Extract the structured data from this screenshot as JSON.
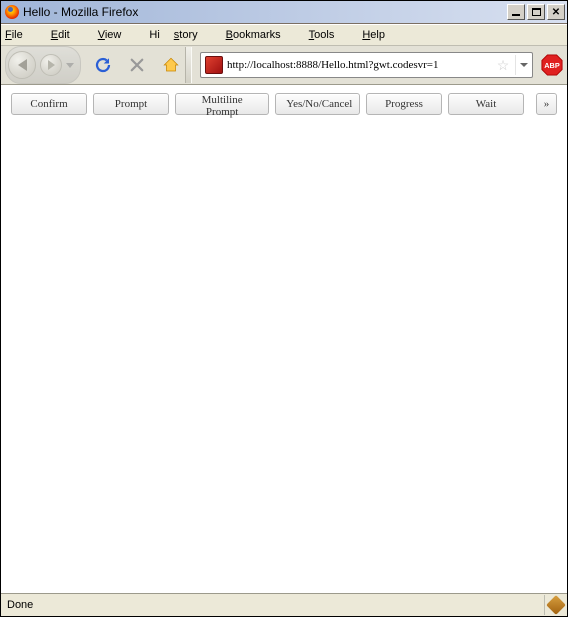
{
  "window": {
    "title": "Hello - Mozilla Firefox"
  },
  "menubar": {
    "file": {
      "letter": "F",
      "rest": "ile"
    },
    "edit": {
      "letter": "E",
      "rest": "dit"
    },
    "view": {
      "letter": "V",
      "rest": "iew"
    },
    "history": {
      "letter": "",
      "rest1": "Hi",
      "letter2": "s",
      "rest2": "tory"
    },
    "bookmarks": {
      "letter": "B",
      "rest": "ookmarks"
    },
    "tools": {
      "letter": "T",
      "rest": "ools"
    },
    "help": {
      "letter": "H",
      "rest": "elp"
    }
  },
  "address": {
    "url": "http://localhost:8888/Hello.html?gwt.codesvr=1"
  },
  "buttons": {
    "confirm": "Confirm",
    "prompt": "Prompt",
    "multiline": "Multiline Prompt",
    "yesnocancel": "Yes/No/Cancel",
    "progress": "Progress",
    "wait": "Wait",
    "more": "»"
  },
  "status": {
    "text": "Done"
  }
}
